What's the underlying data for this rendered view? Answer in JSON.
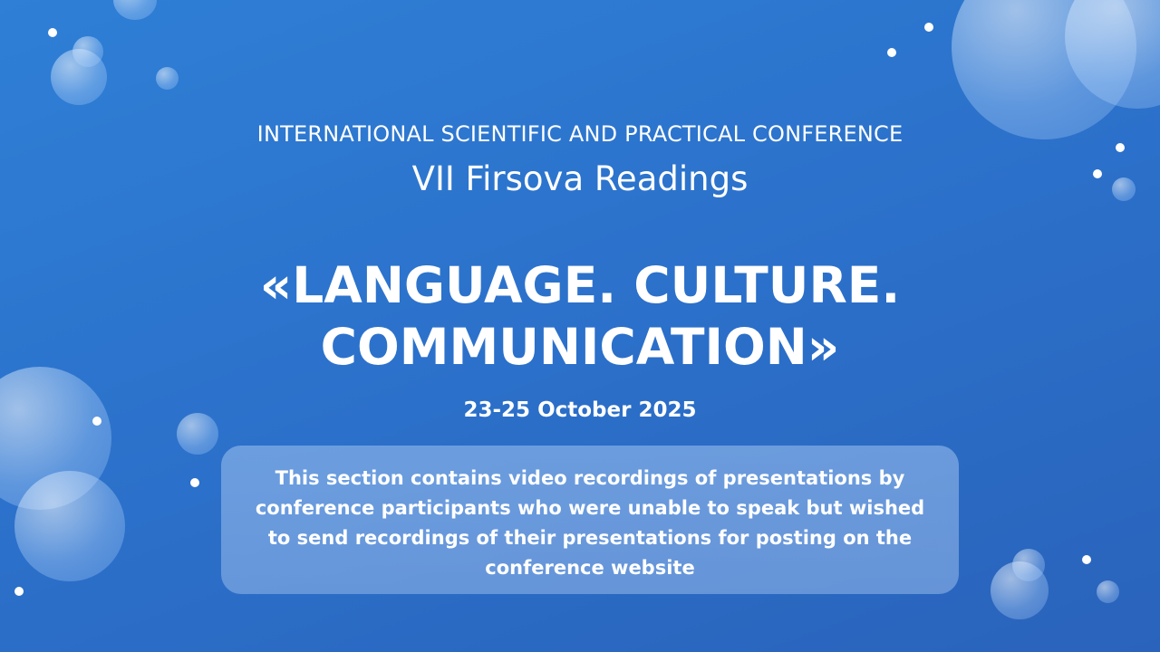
{
  "slide": {
    "subtitle": "INTERNATIONAL SCIENTIFIC AND PRACTICAL CONFERENCE",
    "event_name": "VII Firsova Readings",
    "title_line1": "«LANGUAGE. CULTURE.",
    "title_line2": "COMMUNICATION»",
    "dates": "23-25 October 2025",
    "note": "This section contains video recordings of presentations by conference participants who were unable to speak but wished to send recordings of their presentations for posting on the conference website"
  },
  "colors": {
    "background": "#2b6fc9",
    "text": "#ffffff",
    "note_box": "#9fc3f0"
  }
}
